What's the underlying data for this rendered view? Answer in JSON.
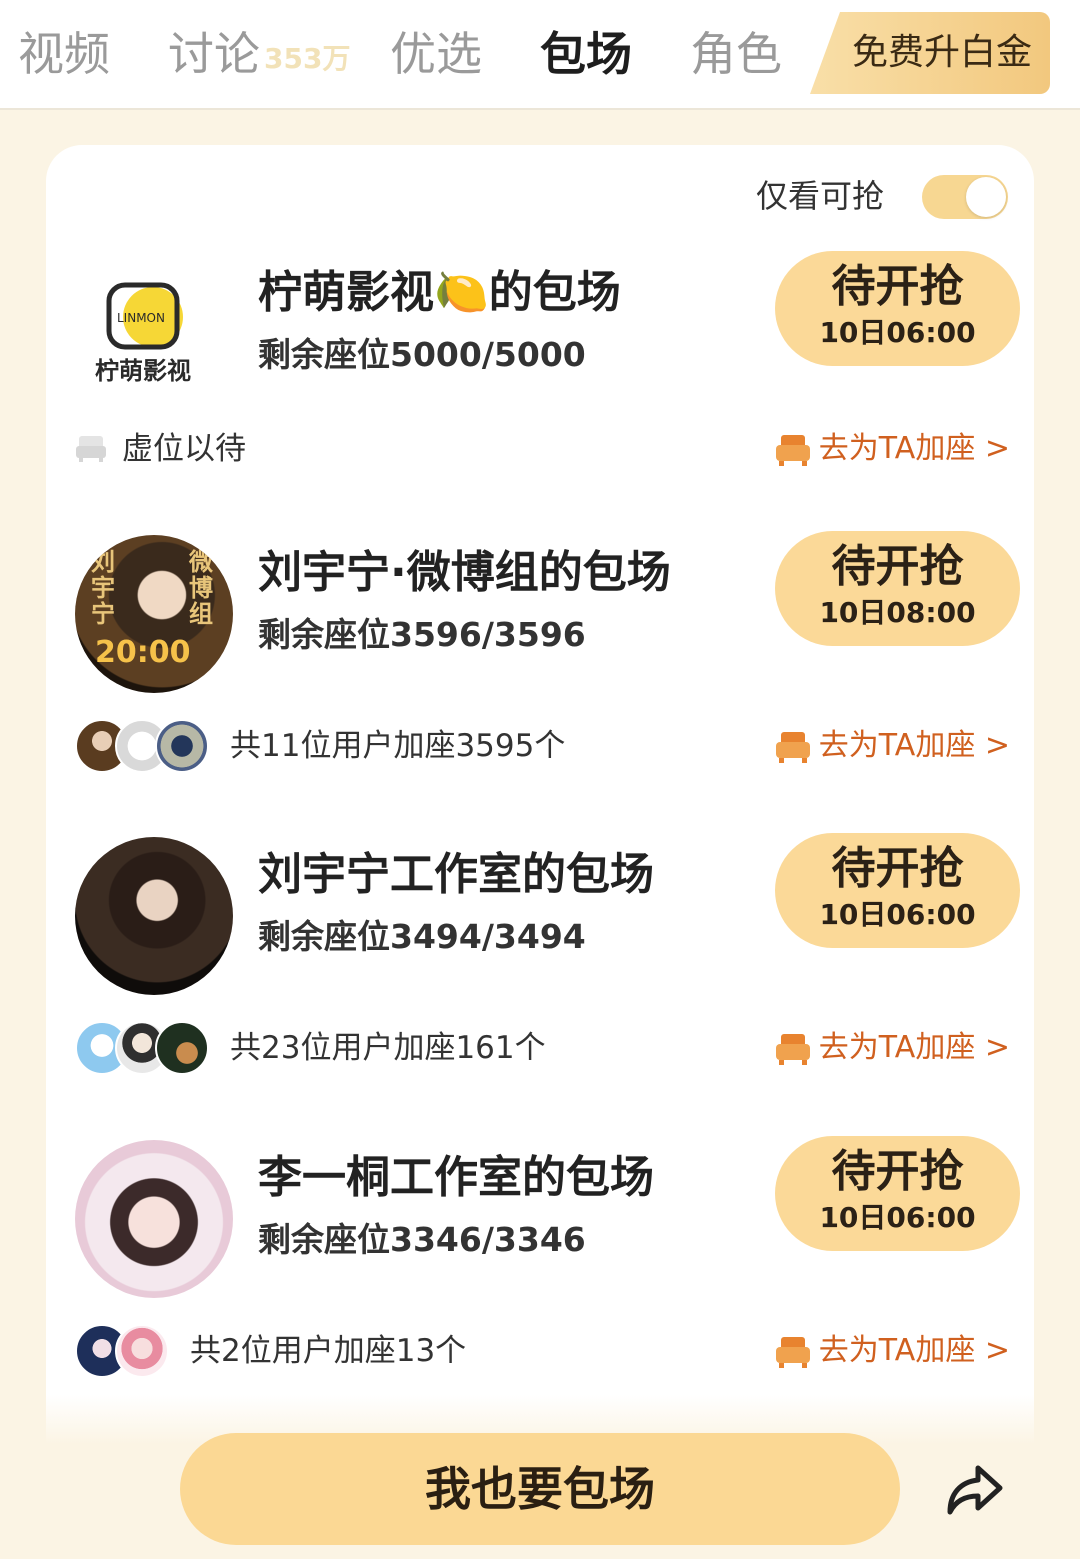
{
  "tabs": [
    {
      "label": "视频",
      "count": ""
    },
    {
      "label": "讨论",
      "count": "353万"
    },
    {
      "label": "优选",
      "count": ""
    },
    {
      "label": "包场",
      "count": ""
    },
    {
      "label": "角色",
      "count": ""
    }
  ],
  "vip_button": "免费升白金",
  "filter": {
    "label": "仅看可抢",
    "enabled": true
  },
  "colors": {
    "accent": "#fbd998",
    "link": "#d0601f",
    "background": "#fbf4e4"
  },
  "entries": [
    {
      "title": "柠萌影视🍋的包场",
      "seats": "剩余座位5000/5000",
      "button_label": "待开抢",
      "button_time": "10日06:00",
      "footer_text": "虚位以待",
      "add_link": "去为TA加座 >",
      "logo_text": "LINMON",
      "logo_caption": "柠萌影视"
    },
    {
      "title": "刘宇宁·微博组的包场",
      "seats": "剩余座位3596/3596",
      "button_label": "待开抢",
      "button_time": "10日08:00",
      "footer_text": "共11位用户加座3595个",
      "add_link": "去为TA加座 >",
      "avatar_overlay_time": "20:00",
      "avatar_overlay_left": "刘宇宁",
      "avatar_overlay_right": "微博组"
    },
    {
      "title": "刘宇宁工作室的包场",
      "seats": "剩余座位3494/3494",
      "button_label": "待开抢",
      "button_time": "10日06:00",
      "footer_text": "共23位用户加座161个",
      "add_link": "去为TA加座 >"
    },
    {
      "title": "李一桐工作室的包场",
      "seats": "剩余座位3346/3346",
      "button_label": "待开抢",
      "button_time": "10日06:00",
      "footer_text": "共2位用户加座13个",
      "add_link": "去为TA加座 >"
    }
  ],
  "cta_label": "我也要包场",
  "icons": [
    "seat-icon",
    "sofa-icon",
    "share-icon"
  ]
}
